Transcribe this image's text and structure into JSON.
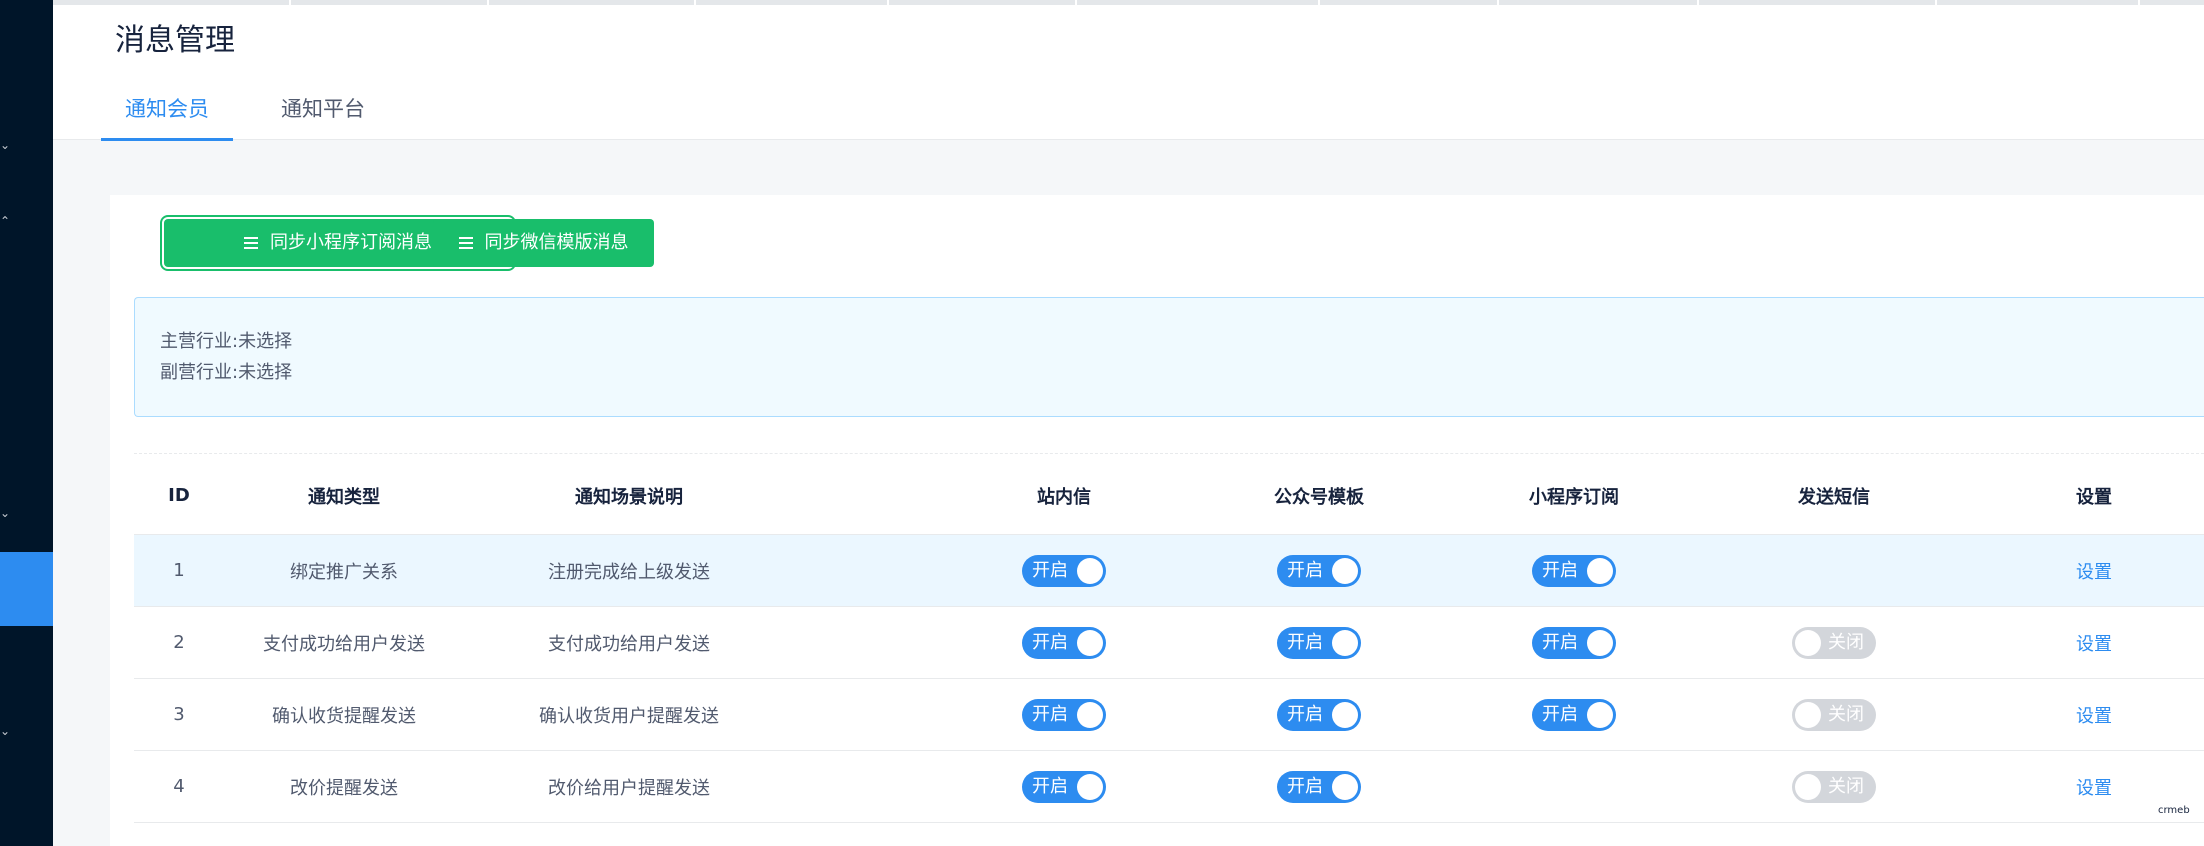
{
  "page": {
    "title": "消息管理"
  },
  "tabs": [
    {
      "label": "通知会员",
      "active": true
    },
    {
      "label": "通知平台",
      "active": false
    }
  ],
  "actions": {
    "sync_miniprogram": "同步小程序订阅消息",
    "sync_wechat": "同步微信模版消息"
  },
  "industry": {
    "primary_label": "主营行业:",
    "primary_value": "未选择",
    "secondary_label": "副营行业:",
    "secondary_value": "未选择"
  },
  "table": {
    "columns": [
      "ID",
      "通知类型",
      "通知场景说明",
      "站内信",
      "公众号模板",
      "小程序订阅",
      "发送短信",
      "设置"
    ],
    "rows": [
      {
        "id": "1",
        "type": "绑定推广关系",
        "scene": "注册完成给上级发送",
        "site": "开启",
        "mp": "开启",
        "mini": "开启",
        "sms": "",
        "action": "设置"
      },
      {
        "id": "2",
        "type": "支付成功给用户发送",
        "scene": "支付成功给用户发送",
        "site": "开启",
        "mp": "开启",
        "mini": "开启",
        "sms": "关闭",
        "action": "设置"
      },
      {
        "id": "3",
        "type": "确认收货提醒发送",
        "scene": "确认收货用户提醒发送",
        "site": "开启",
        "mp": "开启",
        "mini": "开启",
        "sms": "关闭",
        "action": "设置"
      },
      {
        "id": "4",
        "type": "改价提醒发送",
        "scene": "改价给用户提醒发送",
        "site": "开启",
        "mp": "开启",
        "mini": "",
        "sms": "关闭",
        "action": "设置"
      }
    ]
  },
  "watermark": "crmeb",
  "colors": {
    "primary": "#2d8cf0",
    "success": "#19be6b",
    "sidebar": "#001529",
    "switch_off": "#d3d6db"
  }
}
